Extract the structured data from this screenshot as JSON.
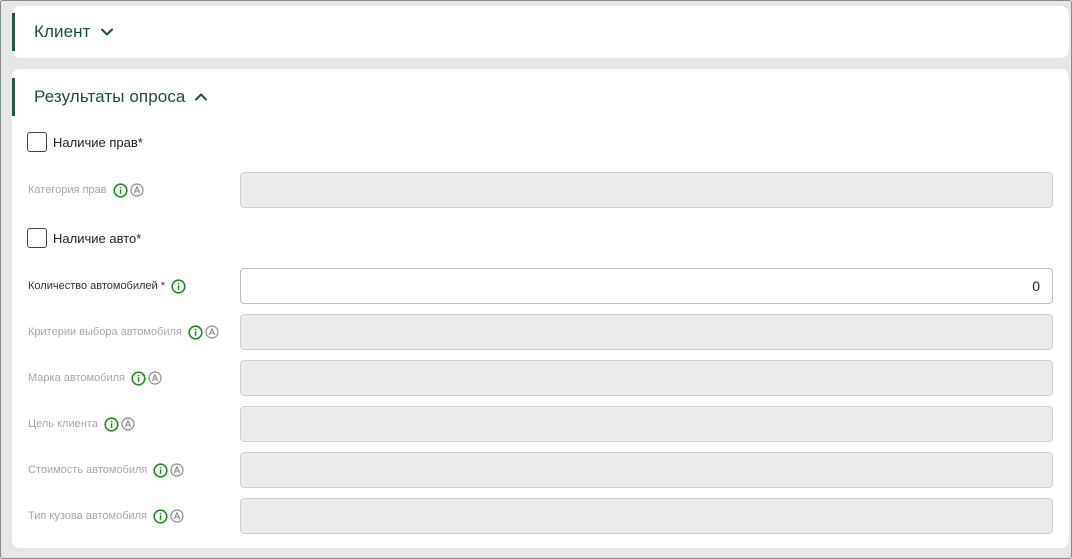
{
  "sections": {
    "client": {
      "title": "Клиент",
      "expanded": false
    },
    "survey": {
      "title": "Результаты опроса",
      "expanded": true
    }
  },
  "form": {
    "has_license": {
      "label": "Наличие прав*",
      "checked": false
    },
    "license_category": {
      "label": "Категория прав",
      "value": "",
      "disabled": true
    },
    "has_car": {
      "label": "Наличие авто*",
      "checked": false
    },
    "car_count": {
      "label": "Количество автомобилей *",
      "value": "0",
      "disabled": false
    },
    "car_criteria": {
      "label": "Критерии выбора автомобиля",
      "value": "",
      "disabled": true
    },
    "car_brand": {
      "label": "Марка автомобиля",
      "value": "",
      "disabled": true
    },
    "client_goal": {
      "label": "Цель клиента",
      "value": "",
      "disabled": true
    },
    "car_price": {
      "label": "Стоимость автомобиля",
      "value": "",
      "disabled": true
    },
    "body_type": {
      "label": "Тип кузова автомобиля",
      "value": "",
      "disabled": true
    }
  },
  "icons": {
    "info": "info-icon",
    "auto": "auto-a-icon",
    "expand": "chevron-down-icon",
    "collapse": "chevron-up-icon"
  },
  "colors": {
    "accent": "#1f5a45",
    "info_green": "#1e8a1e",
    "disabled_bg": "#ececec"
  }
}
